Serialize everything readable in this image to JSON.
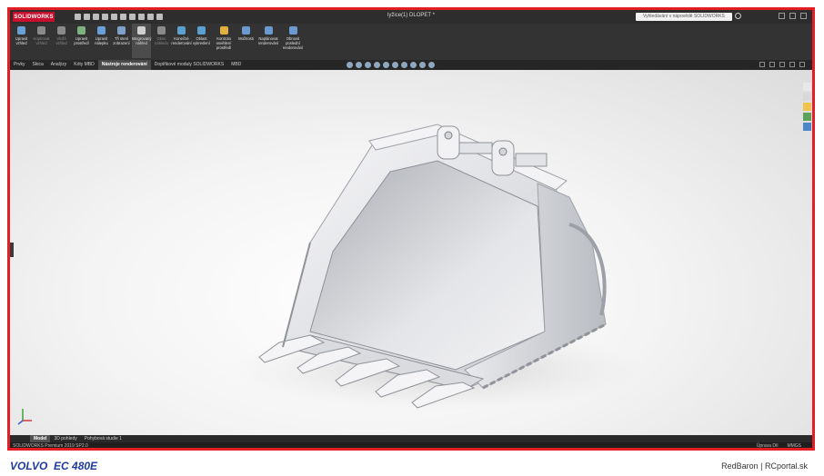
{
  "app": {
    "logo_text": "SOLIDWORKS",
    "document_title": "lyžice(1) DLOPET *",
    "search_placeholder": "Vyhledávání v nápovědě SOLIDWORKS"
  },
  "ribbon": {
    "buttons": [
      {
        "label": "Upravit vzhled",
        "icon": "appearance-icon",
        "enabled": true
      },
      {
        "label": "Kopírovat vzhled",
        "icon": "copy-appearance-icon",
        "enabled": false
      },
      {
        "label": "Vložit vzhled",
        "icon": "paste-appearance-icon",
        "enabled": false
      },
      {
        "label": "Upravit prostředí",
        "icon": "scene-icon",
        "enabled": true
      },
      {
        "label": "Upravit nálepku",
        "icon": "decal-icon",
        "enabled": true
      },
      {
        "label": "Tři stení zobrazení",
        "icon": "3d-view-icon",
        "enabled": true
      },
      {
        "label": "Integrovaný náhled",
        "icon": "integrated-preview-icon",
        "enabled": true,
        "active": true
      },
      {
        "label": "Okno náhledu",
        "icon": "preview-window-icon",
        "enabled": false
      },
      {
        "label": "Konečné renderování",
        "icon": "final-render-icon",
        "enabled": true
      },
      {
        "label": "Oblast vykreslení",
        "icon": "render-region-icon",
        "enabled": true
      },
      {
        "label": "Kontrola osvětlení prostředí",
        "icon": "lighting-icon",
        "enabled": true
      },
      {
        "label": "Možnosti",
        "icon": "options-icon",
        "enabled": true
      },
      {
        "label": "Naplánovat renderování",
        "icon": "schedule-render-icon",
        "enabled": true
      },
      {
        "label": "Obnovit poslední renderování",
        "icon": "recall-render-icon",
        "enabled": true
      }
    ]
  },
  "tabs": [
    {
      "label": "Prvky",
      "active": false
    },
    {
      "label": "Skica",
      "active": false
    },
    {
      "label": "Analýzy",
      "active": false
    },
    {
      "label": "Kóty MBD",
      "active": false
    },
    {
      "label": "Nástroje renderování",
      "active": true
    },
    {
      "label": "Doplňkové moduly SOLIDWORKS",
      "active": false
    },
    {
      "label": "MBD",
      "active": false
    }
  ],
  "bottom_tabs": [
    {
      "label": "Model",
      "active": true
    },
    {
      "label": "3D pohledy",
      "active": false
    },
    {
      "label": "Pohybová studie 1",
      "active": false
    }
  ],
  "status": {
    "left": "SOLIDWORKS Premium 2019 SP2.0",
    "mode": "Úprava Díl",
    "units": "MMGS"
  },
  "caption": {
    "left": "VOLVO  EC 480E",
    "right": "RedBaron | RCportal.sk"
  },
  "colors": {
    "frame": "#e31e24",
    "caption_left": "#1f3b9e",
    "ribbon_bg": "#333333",
    "titlebar_bg": "#2d2d2d"
  }
}
